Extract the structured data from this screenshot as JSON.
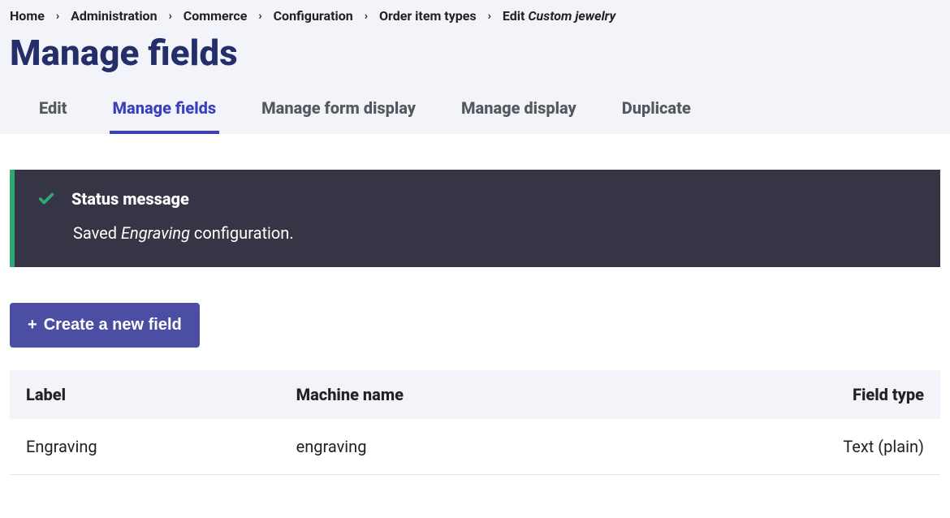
{
  "breadcrumb": {
    "items": [
      {
        "label": "Home"
      },
      {
        "label": "Administration"
      },
      {
        "label": "Commerce"
      },
      {
        "label": "Configuration"
      },
      {
        "label": "Order item types"
      }
    ],
    "current_prefix": "Edit ",
    "current_em": "Custom jewelry"
  },
  "page_title": "Manage fields",
  "tabs": {
    "edit": "Edit",
    "manage_fields": "Manage fields",
    "manage_form_display": "Manage form display",
    "manage_display": "Manage display",
    "duplicate": "Duplicate"
  },
  "status": {
    "title": "Status message",
    "body_prefix": "Saved ",
    "body_em": "Engraving",
    "body_suffix": " configuration."
  },
  "buttons": {
    "create_field": "Create a new field",
    "plus": "+"
  },
  "table": {
    "headers": {
      "label": "Label",
      "machine_name": "Machine name",
      "field_type": "Field type"
    },
    "rows": [
      {
        "label": "Engraving",
        "machine_name": "engraving",
        "field_type": "Text (plain)"
      }
    ]
  }
}
